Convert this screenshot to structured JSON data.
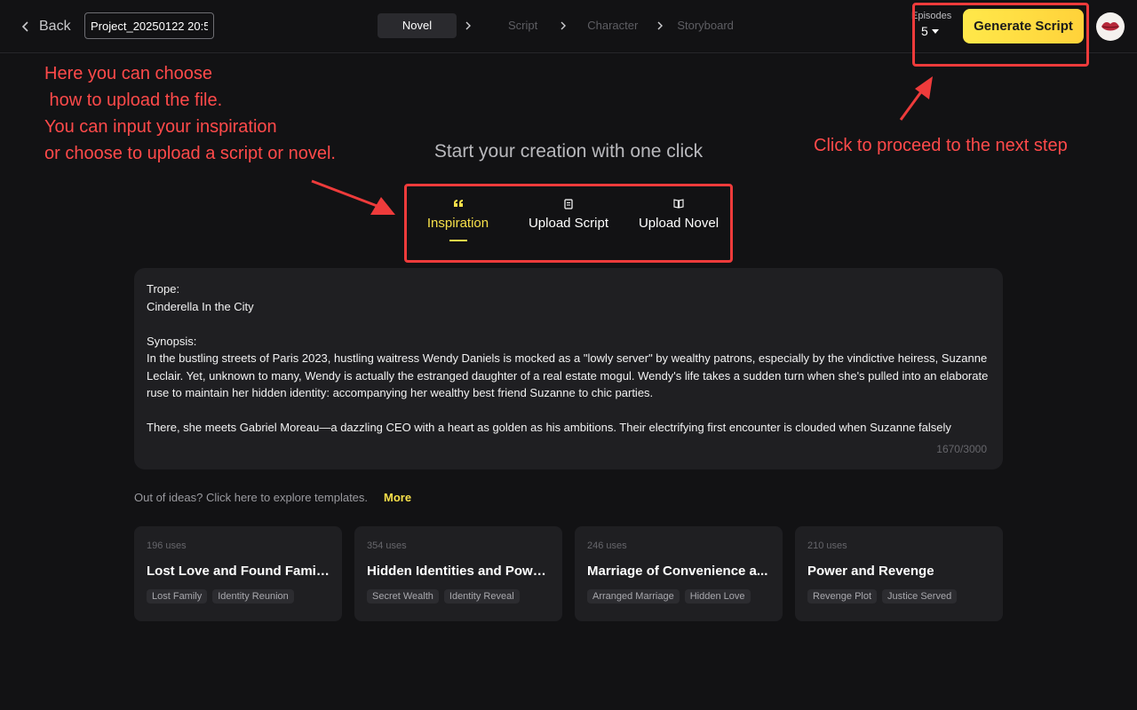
{
  "header": {
    "back_label": "Back",
    "project_name": "Project_20250122 20:5",
    "steps": [
      "Novel",
      "Script",
      "Character",
      "Storyboard"
    ],
    "active_step": "Novel",
    "episodes_label": "Episodes",
    "episodes_value": "5",
    "generate_label": "Generate Script"
  },
  "annotations": {
    "upload_hint": "Here you can choose\n how to upload the file.\nYou can input your inspiration\nor choose to upload a script or novel.",
    "next_hint": "Click to proceed to the next step",
    "color": "#ff4a4a"
  },
  "main": {
    "headline": "Start your creation with one click",
    "tabs": [
      {
        "label": "Inspiration",
        "icon": "quote-icon",
        "active": true
      },
      {
        "label": "Upload Script",
        "icon": "script-file-icon",
        "active": false
      },
      {
        "label": "Upload Novel",
        "icon": "book-icon",
        "active": false
      }
    ],
    "editor_text": "Trope:\nCinderella In the City\n\nSynopsis:\nIn the bustling streets of Paris 2023, hustling waitress Wendy Daniels is mocked as a \"lowly server\" by wealthy patrons, especially by the vindictive heiress, Suzanne Leclair. Yet, unknown to many, Wendy is actually the estranged daughter of a real estate mogul. Wendy's life takes a sudden turn when she's pulled into an elaborate ruse to maintain her hidden identity: accompanying her wealthy best friend Suzanne to chic parties.\n\nThere, she meets Gabriel Moreau—a dazzling CEO with a heart as golden as his ambitions. Their electrifying first encounter is clouded when Suzanne falsely accuses",
    "char_count": "1670/3000",
    "explore_text": "Out of ideas? Click here to explore templates.",
    "more_label": "More"
  },
  "templates": [
    {
      "uses": "196 uses",
      "title": "Lost Love and Found Families",
      "tags": [
        "Lost Family",
        "Identity Reunion"
      ]
    },
    {
      "uses": "354 uses",
      "title": "Hidden Identities and Powe...",
      "tags": [
        "Secret Wealth",
        "Identity Reveal"
      ]
    },
    {
      "uses": "246 uses",
      "title": "Marriage of Convenience a...",
      "tags": [
        "Arranged Marriage",
        "Hidden Love"
      ]
    },
    {
      "uses": "210 uses",
      "title": "Power and Revenge",
      "tags": [
        "Revenge Plot",
        "Justice Served"
      ]
    }
  ],
  "colors": {
    "accent": "#f7e04a",
    "background": "#121214",
    "card": "#1f1f22"
  }
}
